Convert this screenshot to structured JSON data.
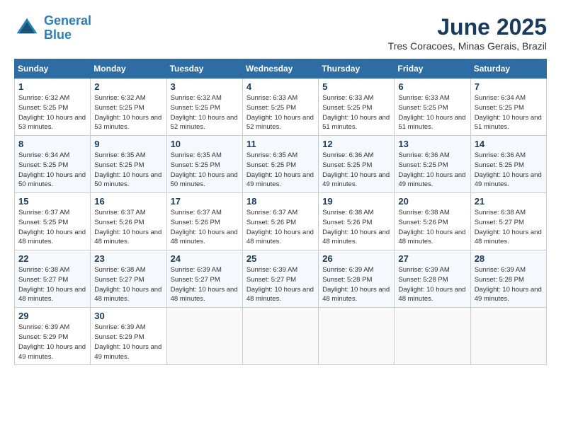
{
  "header": {
    "logo_line1": "General",
    "logo_line2": "Blue",
    "month": "June 2025",
    "location": "Tres Coracoes, Minas Gerais, Brazil"
  },
  "weekdays": [
    "Sunday",
    "Monday",
    "Tuesday",
    "Wednesday",
    "Thursday",
    "Friday",
    "Saturday"
  ],
  "weeks": [
    [
      {
        "day": "1",
        "sunrise": "6:32 AM",
        "sunset": "5:25 PM",
        "daylight": "10 hours and 53 minutes."
      },
      {
        "day": "2",
        "sunrise": "6:32 AM",
        "sunset": "5:25 PM",
        "daylight": "10 hours and 53 minutes."
      },
      {
        "day": "3",
        "sunrise": "6:32 AM",
        "sunset": "5:25 PM",
        "daylight": "10 hours and 52 minutes."
      },
      {
        "day": "4",
        "sunrise": "6:33 AM",
        "sunset": "5:25 PM",
        "daylight": "10 hours and 52 minutes."
      },
      {
        "day": "5",
        "sunrise": "6:33 AM",
        "sunset": "5:25 PM",
        "daylight": "10 hours and 51 minutes."
      },
      {
        "day": "6",
        "sunrise": "6:33 AM",
        "sunset": "5:25 PM",
        "daylight": "10 hours and 51 minutes."
      },
      {
        "day": "7",
        "sunrise": "6:34 AM",
        "sunset": "5:25 PM",
        "daylight": "10 hours and 51 minutes."
      }
    ],
    [
      {
        "day": "8",
        "sunrise": "6:34 AM",
        "sunset": "5:25 PM",
        "daylight": "10 hours and 50 minutes."
      },
      {
        "day": "9",
        "sunrise": "6:35 AM",
        "sunset": "5:25 PM",
        "daylight": "10 hours and 50 minutes."
      },
      {
        "day": "10",
        "sunrise": "6:35 AM",
        "sunset": "5:25 PM",
        "daylight": "10 hours and 50 minutes."
      },
      {
        "day": "11",
        "sunrise": "6:35 AM",
        "sunset": "5:25 PM",
        "daylight": "10 hours and 49 minutes."
      },
      {
        "day": "12",
        "sunrise": "6:36 AM",
        "sunset": "5:25 PM",
        "daylight": "10 hours and 49 minutes."
      },
      {
        "day": "13",
        "sunrise": "6:36 AM",
        "sunset": "5:25 PM",
        "daylight": "10 hours and 49 minutes."
      },
      {
        "day": "14",
        "sunrise": "6:36 AM",
        "sunset": "5:25 PM",
        "daylight": "10 hours and 49 minutes."
      }
    ],
    [
      {
        "day": "15",
        "sunrise": "6:37 AM",
        "sunset": "5:25 PM",
        "daylight": "10 hours and 48 minutes."
      },
      {
        "day": "16",
        "sunrise": "6:37 AM",
        "sunset": "5:26 PM",
        "daylight": "10 hours and 48 minutes."
      },
      {
        "day": "17",
        "sunrise": "6:37 AM",
        "sunset": "5:26 PM",
        "daylight": "10 hours and 48 minutes."
      },
      {
        "day": "18",
        "sunrise": "6:37 AM",
        "sunset": "5:26 PM",
        "daylight": "10 hours and 48 minutes."
      },
      {
        "day": "19",
        "sunrise": "6:38 AM",
        "sunset": "5:26 PM",
        "daylight": "10 hours and 48 minutes."
      },
      {
        "day": "20",
        "sunrise": "6:38 AM",
        "sunset": "5:26 PM",
        "daylight": "10 hours and 48 minutes."
      },
      {
        "day": "21",
        "sunrise": "6:38 AM",
        "sunset": "5:27 PM",
        "daylight": "10 hours and 48 minutes."
      }
    ],
    [
      {
        "day": "22",
        "sunrise": "6:38 AM",
        "sunset": "5:27 PM",
        "daylight": "10 hours and 48 minutes."
      },
      {
        "day": "23",
        "sunrise": "6:38 AM",
        "sunset": "5:27 PM",
        "daylight": "10 hours and 48 minutes."
      },
      {
        "day": "24",
        "sunrise": "6:39 AM",
        "sunset": "5:27 PM",
        "daylight": "10 hours and 48 minutes."
      },
      {
        "day": "25",
        "sunrise": "6:39 AM",
        "sunset": "5:27 PM",
        "daylight": "10 hours and 48 minutes."
      },
      {
        "day": "26",
        "sunrise": "6:39 AM",
        "sunset": "5:28 PM",
        "daylight": "10 hours and 48 minutes."
      },
      {
        "day": "27",
        "sunrise": "6:39 AM",
        "sunset": "5:28 PM",
        "daylight": "10 hours and 48 minutes."
      },
      {
        "day": "28",
        "sunrise": "6:39 AM",
        "sunset": "5:28 PM",
        "daylight": "10 hours and 49 minutes."
      }
    ],
    [
      {
        "day": "29",
        "sunrise": "6:39 AM",
        "sunset": "5:29 PM",
        "daylight": "10 hours and 49 minutes."
      },
      {
        "day": "30",
        "sunrise": "6:39 AM",
        "sunset": "5:29 PM",
        "daylight": "10 hours and 49 minutes."
      },
      null,
      null,
      null,
      null,
      null
    ]
  ]
}
